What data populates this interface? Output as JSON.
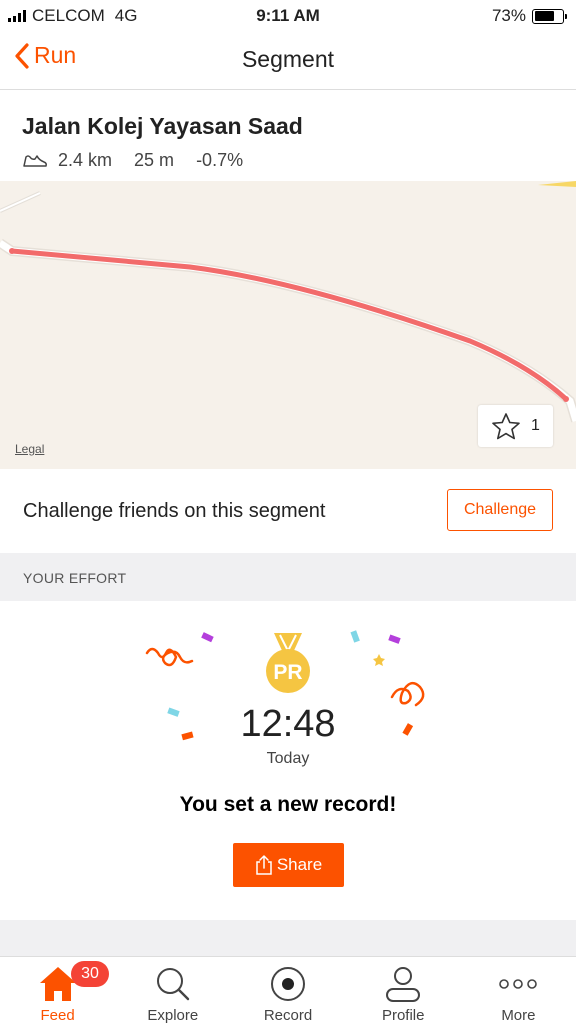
{
  "status_bar": {
    "carrier": "CELCOM",
    "network": "4G",
    "time": "9:11 AM",
    "battery": "73%",
    "battery_level": 0.73
  },
  "nav": {
    "back_label": "Run",
    "title": "Segment"
  },
  "segment": {
    "name": "Jalan Kolej Yayasan Saad",
    "distance": "2.4 km",
    "elevation": "25 m",
    "grade": "-0.7%"
  },
  "map": {
    "star_count": "1",
    "legal_label": "Legal",
    "route_color": "#f26b6b"
  },
  "challenge": {
    "text": "Challenge friends on this segment",
    "button_label": "Challenge"
  },
  "effort": {
    "section_title": "YOUR EFFORT",
    "medal_label": "PR",
    "time": "12:48",
    "date": "Today",
    "record_text": "You set a new record!",
    "share_label": "Share"
  },
  "tab_bar": {
    "tabs": [
      {
        "label": "Feed",
        "icon": "home-icon",
        "badge": "30",
        "active": true
      },
      {
        "label": "Explore",
        "icon": "search-icon"
      },
      {
        "label": "Record",
        "icon": "record-icon"
      },
      {
        "label": "Profile",
        "icon": "profile-icon"
      },
      {
        "label": "More",
        "icon": "more-icon"
      }
    ]
  },
  "colors": {
    "accent": "#fc5200",
    "medal": "#f5c542",
    "badge": "#f44336"
  }
}
